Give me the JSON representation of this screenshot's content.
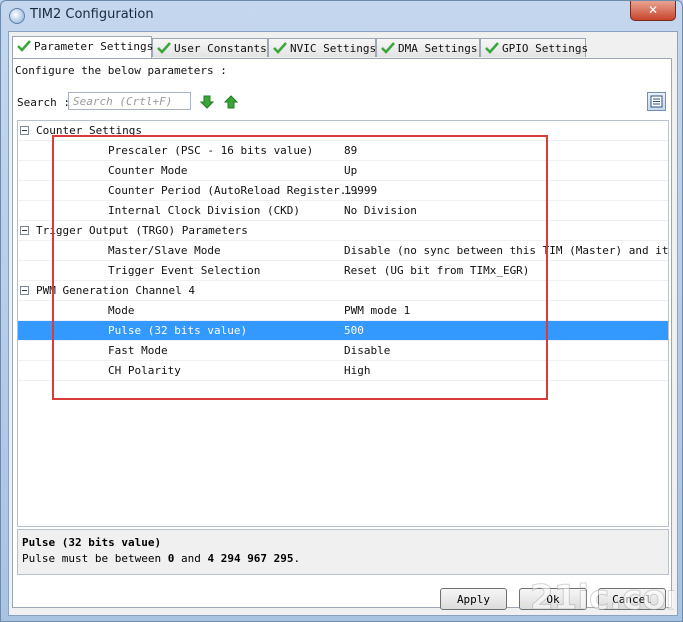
{
  "window": {
    "title": "TIM2 Configuration",
    "close_label": "✕"
  },
  "tabs": [
    {
      "label": "Parameter Settings",
      "active": true
    },
    {
      "label": "User Constants",
      "active": false
    },
    {
      "label": "NVIC Settings",
      "active": false
    },
    {
      "label": "DMA Settings",
      "active": false
    },
    {
      "label": "GPIO Settings",
      "active": false
    }
  ],
  "description": "Configure the below parameters :",
  "search": {
    "label": "Search :",
    "placeholder": "Search (Crtl+F)"
  },
  "groups": [
    {
      "name": "Counter Settings",
      "params": [
        {
          "name": "Prescaler (PSC - 16 bits value)",
          "value": "89"
        },
        {
          "name": "Counter Mode",
          "value": "Up"
        },
        {
          "name": "Counter Period (AutoReload Register...",
          "value": "19999"
        },
        {
          "name": "Internal Clock Division (CKD)",
          "value": "No Division"
        }
      ]
    },
    {
      "name": "Trigger Output (TRGO) Parameters",
      "params": [
        {
          "name": "Master/Slave Mode",
          "value": "Disable (no sync between this TIM (Master) and its ..."
        },
        {
          "name": "Trigger Event Selection",
          "value": "Reset (UG bit from TIMx_EGR)"
        }
      ]
    },
    {
      "name": "PWM Generation Channel 4",
      "params": [
        {
          "name": "Mode",
          "value": "PWM mode 1"
        },
        {
          "name": "Pulse (32 bits value)",
          "value": "500",
          "selected": true
        },
        {
          "name": "Fast Mode",
          "value": "Disable"
        },
        {
          "name": "CH Polarity",
          "value": "High"
        }
      ]
    }
  ],
  "info": {
    "title": "Pulse (32 bits value)",
    "text_prefix": "Pulse must be between ",
    "min": "0",
    "text_mid": " and ",
    "max": "4 294 967 295",
    "text_suffix": "."
  },
  "buttons": {
    "apply": "Apply",
    "ok": "Ok",
    "cancel": "Cancel"
  },
  "watermark": "21ic.com",
  "colors": {
    "selection": "#3399ff",
    "highlight_box": "#d93a3a",
    "check": "#3aa63a"
  }
}
